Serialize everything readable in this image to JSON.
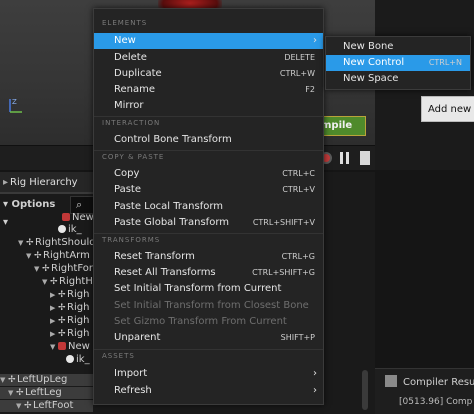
{
  "viewport": {
    "compile_label": "mpile"
  },
  "tooltip": {
    "text": "Add new co"
  },
  "rig": {
    "tab_label": "Rig Hierarchy",
    "options_label": "Options",
    "rows": [
      {
        "label": "New",
        "kind": "ctrl"
      },
      {
        "label": "ik_",
        "kind": "bone"
      },
      {
        "label": "RightShould",
        "kind": "bone"
      },
      {
        "label": "RightArm",
        "kind": "bone"
      },
      {
        "label": "RightFor",
        "kind": "bone"
      },
      {
        "label": "RightH",
        "kind": "bone"
      },
      {
        "label": "Righ",
        "kind": "bone"
      },
      {
        "label": "Righ",
        "kind": "bone"
      },
      {
        "label": "Righ",
        "kind": "bone"
      },
      {
        "label": "Righ",
        "kind": "bone"
      },
      {
        "label": "New",
        "kind": "ctrl"
      },
      {
        "label": "ik_",
        "kind": "bone"
      },
      {
        "label": "LeftUpLeg",
        "kind": "bone"
      },
      {
        "label": "LeftLeg",
        "kind": "bone"
      },
      {
        "label": "LeftFoot",
        "kind": "bone"
      }
    ]
  },
  "compiler": {
    "title": "Compiler Result",
    "line": "[0513.96] Comp"
  },
  "menu": {
    "sections": {
      "elements": "ELEMENTS",
      "interaction": "INTERACTION",
      "copy_paste": "COPY & PASTE",
      "transforms": "TRANSFORMS",
      "assets": "ASSETS"
    },
    "items": {
      "new": {
        "label": "New"
      },
      "delete": {
        "label": "Delete",
        "shortcut": "DELETE"
      },
      "duplicate": {
        "label": "Duplicate",
        "shortcut": "CTRL+W"
      },
      "rename": {
        "label": "Rename",
        "shortcut": "F2"
      },
      "mirror": {
        "label": "Mirror"
      },
      "control_bone_transform": {
        "label": "Control Bone Transform"
      },
      "copy": {
        "label": "Copy",
        "shortcut": "CTRL+C"
      },
      "paste": {
        "label": "Paste",
        "shortcut": "CTRL+V"
      },
      "paste_local": {
        "label": "Paste Local Transform"
      },
      "paste_global": {
        "label": "Paste Global Transform",
        "shortcut": "CTRL+SHIFT+V"
      },
      "reset_transform": {
        "label": "Reset Transform",
        "shortcut": "CTRL+G"
      },
      "reset_all": {
        "label": "Reset All Transforms",
        "shortcut": "CTRL+SHIFT+G"
      },
      "set_initial_current": {
        "label": "Set Initial Transform from Current"
      },
      "set_initial_closest": {
        "label": "Set Initial Transform from Closest Bone"
      },
      "set_gizmo_current": {
        "label": "Set Gizmo Transform From Current"
      },
      "unparent": {
        "label": "Unparent",
        "shortcut": "SHIFT+P"
      },
      "import": {
        "label": "Import"
      },
      "refresh": {
        "label": "Refresh"
      }
    }
  },
  "submenu": {
    "new_bone": {
      "label": "New Bone"
    },
    "new_control": {
      "label": "New Control",
      "shortcut": "CTRL+N"
    },
    "new_space": {
      "label": "New Space"
    }
  },
  "colors": {
    "highlight": "#2a9ae8",
    "compile_green": "#4f8a2b",
    "control_red": "#c23838"
  }
}
